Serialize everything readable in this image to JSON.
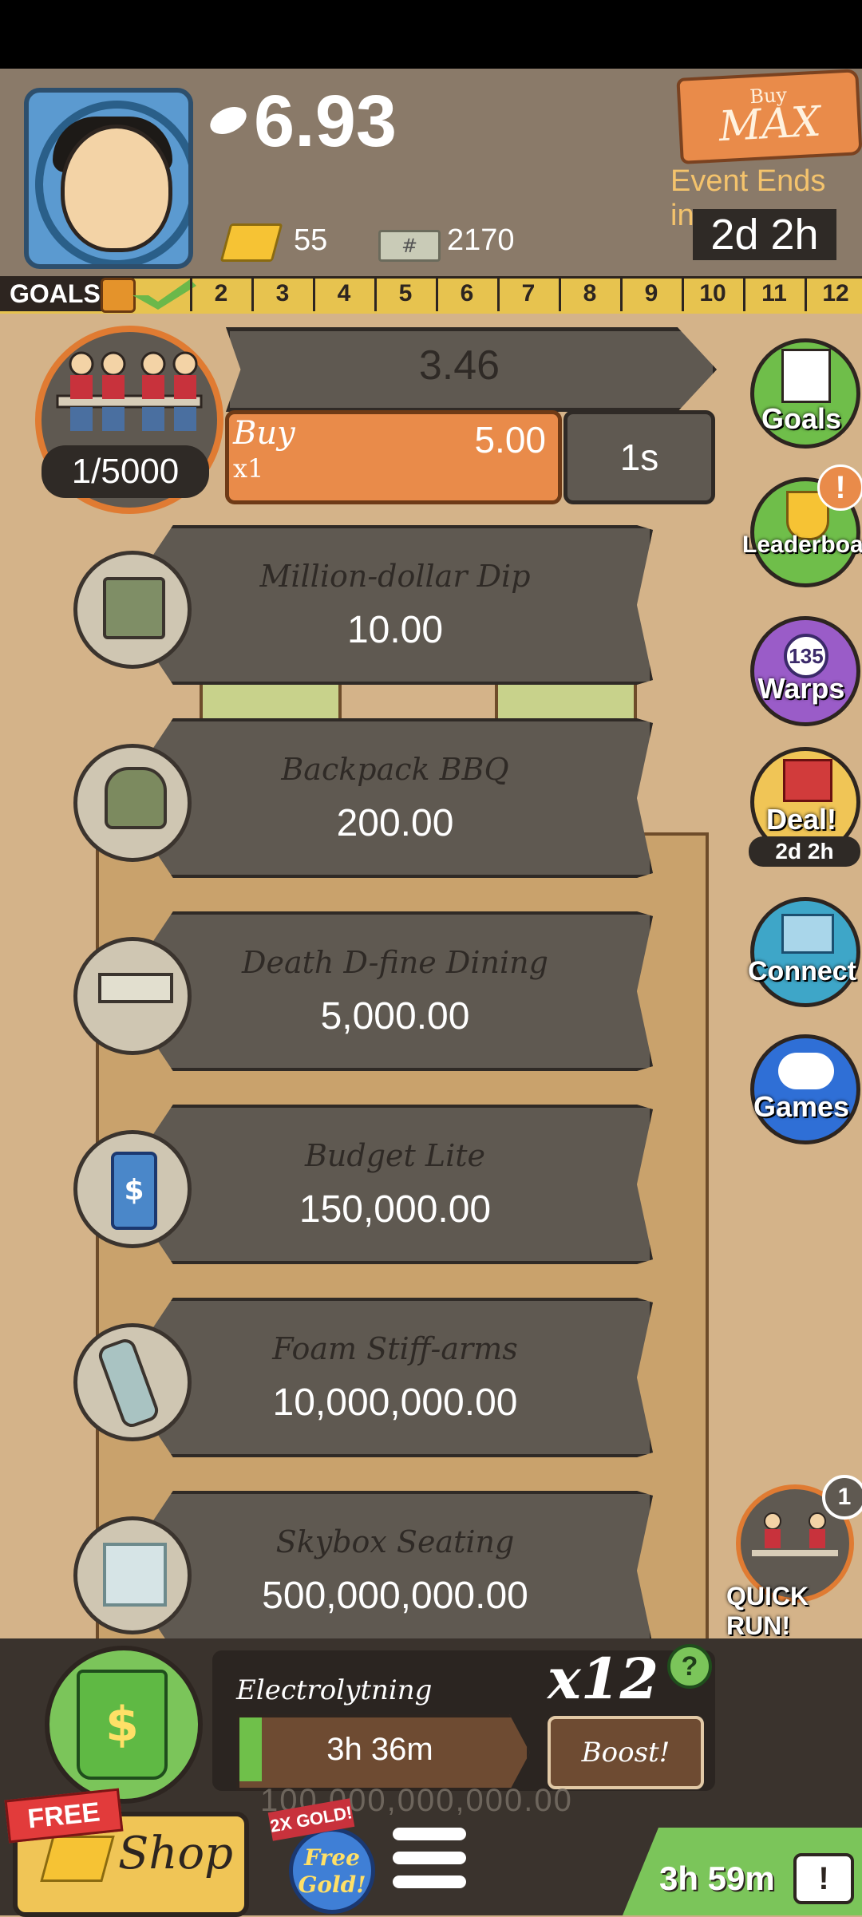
{
  "header": {
    "football_value": "6.93",
    "gold_count": "55",
    "cash_count": "2170",
    "buy_max_small": "Buy",
    "buy_max_big": "MAX",
    "event_label": "Event Ends in:",
    "event_time": "2d 2h"
  },
  "goals": {
    "label": "GOALS",
    "numbers": [
      "2",
      "3",
      "4",
      "5",
      "6",
      "7",
      "8",
      "9",
      "10",
      "11",
      "12"
    ]
  },
  "manager": {
    "count": "1/5000",
    "progress_value": "3.46",
    "buy_label": "Buy",
    "buy_multiplier": "x1",
    "buy_cost": "5.00",
    "timer": "1s"
  },
  "businesses": [
    {
      "name": "Million-dollar Dip",
      "value": "10.00",
      "icon": "cooler-icon"
    },
    {
      "name": "Backpack BBQ",
      "value": "200.00",
      "icon": "backpack-icon"
    },
    {
      "name": "Death D-fine Dining",
      "value": "5,000.00",
      "icon": "table-icon"
    },
    {
      "name": "Budget Lite",
      "value": "150,000.00",
      "icon": "can-icon"
    },
    {
      "name": "Foam Stiff-arms",
      "value": "10,000,000.00",
      "icon": "foam-arm-icon"
    },
    {
      "name": "Skybox Seating",
      "value": "500,000,000.00",
      "icon": "seat-icon"
    }
  ],
  "side": {
    "goals": "Goals",
    "leaderboard": "Leaderboard",
    "leaderboard_alert": "!",
    "warps": "Warps",
    "warps_count": "135",
    "deal": "Deal!",
    "deal_timer": "2d 2h",
    "connect": "Connect",
    "games": "Games",
    "quickrun_label": "QUICK RUN!",
    "quickrun_badge": "1"
  },
  "bottom": {
    "event_name": "Electrolytning",
    "event_time": "3h 36m",
    "multiplier": "x12",
    "help": "?",
    "boost": "Boost!",
    "shop": "Shop",
    "free": "FREE",
    "twox": "2X GOLD!",
    "free_gold": "Free Gold!",
    "tv_timer": "3h 59m",
    "tv_icon": "!",
    "ghost_text": "100,000,000,000.00"
  },
  "colors": {
    "accent_orange": "#e98b4a",
    "gold": "#f6c334",
    "green": "#7bc55a",
    "dark": "#2f2a26"
  }
}
